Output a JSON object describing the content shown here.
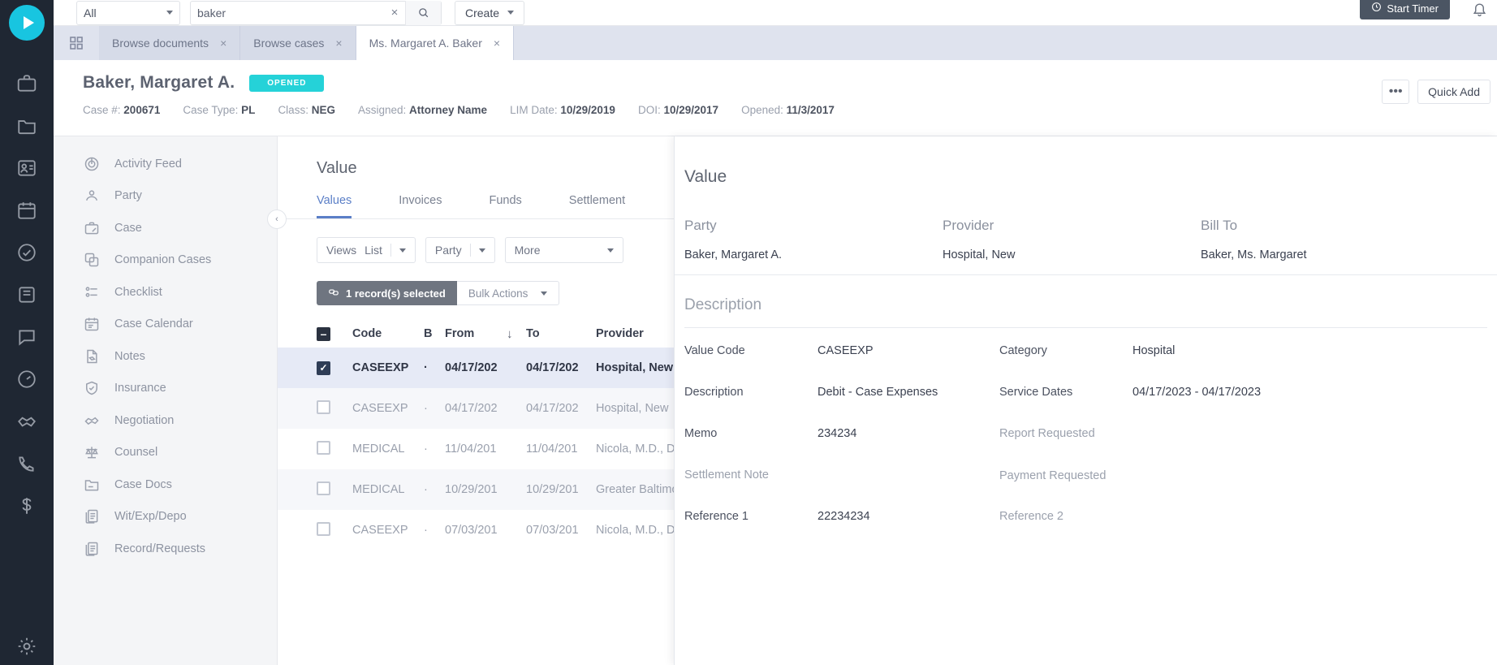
{
  "topbar": {
    "scope_label": "All",
    "search_value": "baker",
    "search_placeholder": "Search",
    "clear_label": "×",
    "create_label": "Create",
    "timer_label": "Start Timer"
  },
  "tabs": [
    {
      "label": "Browse documents",
      "close": "×",
      "active": false
    },
    {
      "label": "Browse cases",
      "close": "×",
      "active": false
    },
    {
      "label": "Ms. Margaret A. Baker",
      "close": "×",
      "active": true
    }
  ],
  "case_header": {
    "title": "Baker, Margaret A.",
    "status_badge": "OPENED",
    "meta": [
      {
        "label": "Case #:",
        "value": "200671"
      },
      {
        "label": "Case Type:",
        "value": "PL"
      },
      {
        "label": "Class:",
        "value": "NEG"
      },
      {
        "label": "Assigned:",
        "value": "Attorney Name"
      },
      {
        "label": "LIM Date:",
        "value": "10/29/2019"
      },
      {
        "label": "DOI:",
        "value": "10/29/2017"
      },
      {
        "label": "Opened:",
        "value": "11/3/2017"
      }
    ],
    "more_label": "•••",
    "quick_add_label": "Quick Add"
  },
  "sidebar": {
    "items": [
      {
        "label": "Activity Feed",
        "icon": "activity-feed-icon"
      },
      {
        "label": "Party",
        "icon": "party-icon"
      },
      {
        "label": "Case",
        "icon": "case-icon"
      },
      {
        "label": "Companion Cases",
        "icon": "companion-cases-icon"
      },
      {
        "label": "Checklist",
        "icon": "checklist-icon"
      },
      {
        "label": "Case Calendar",
        "icon": "calendar-icon"
      },
      {
        "label": "Notes",
        "icon": "notes-icon"
      },
      {
        "label": "Insurance",
        "icon": "shield-icon"
      },
      {
        "label": "Negotiation",
        "icon": "negotiation-icon"
      },
      {
        "label": "Counsel",
        "icon": "scales-icon"
      },
      {
        "label": "Case Docs",
        "icon": "folder-icon"
      },
      {
        "label": "Wit/Exp/Depo",
        "icon": "documents-icon"
      },
      {
        "label": "Record/Requests",
        "icon": "documents-icon"
      }
    ],
    "collapse_label": "‹"
  },
  "main": {
    "title": "Value",
    "tabs": [
      {
        "label": "Values",
        "active": true
      },
      {
        "label": "Invoices",
        "active": false
      },
      {
        "label": "Funds",
        "active": false
      },
      {
        "label": "Settlement",
        "active": false
      }
    ],
    "filters": [
      {
        "label": "Views",
        "value": "List"
      },
      {
        "label": "Party",
        "value": ""
      },
      {
        "label": "More",
        "value": ""
      }
    ],
    "bulk": {
      "count_label": "1 record(s) selected",
      "actions_label": "Bulk Actions"
    },
    "table": {
      "columns": [
        "Code",
        "B",
        "From",
        "To",
        "Provider"
      ],
      "sort_column": "From",
      "sort_direction": "↓",
      "header_checkbox": "indeterminate",
      "rows": [
        {
          "checked": true,
          "code": "CASEEXP",
          "b": "·",
          "from": "04/17/202",
          "to": "04/17/202",
          "provider": "Hospital, New"
        },
        {
          "checked": false,
          "code": "CASEEXP",
          "b": "·",
          "from": "04/17/202",
          "to": "04/17/202",
          "provider": "Hospital, New"
        },
        {
          "checked": false,
          "code": "MEDICAL",
          "b": "·",
          "from": "11/04/201",
          "to": "11/04/201",
          "provider": "Nicola, M.D., Dr. Cha"
        },
        {
          "checked": false,
          "code": "MEDICAL",
          "b": "·",
          "from": "10/29/201",
          "to": "10/29/201",
          "provider": "Greater Baltimore M"
        },
        {
          "checked": false,
          "code": "CASEEXP",
          "b": "·",
          "from": "07/03/201",
          "to": "07/03/201",
          "provider": "Nicola, M.D., Dr. Cha"
        }
      ]
    }
  },
  "drawer": {
    "title": "Value",
    "summary_columns": [
      "Party",
      "Provider",
      "Bill To"
    ],
    "summary_values": [
      "Baker, Margaret A.",
      "Hospital, New",
      "Baker, Ms. Margaret"
    ],
    "section_title": "Description",
    "fields_left": [
      {
        "label": "Value Code",
        "value": "CASEEXP",
        "muted": false
      },
      {
        "label": "Description",
        "value": "Debit - Case Expenses",
        "muted": false
      },
      {
        "label": "Memo",
        "value": "234234",
        "muted": false
      },
      {
        "label": "Settlement Note",
        "value": "",
        "muted": true
      },
      {
        "label": "Reference 1",
        "value": "22234234",
        "muted": false
      }
    ],
    "fields_right": [
      {
        "label": "Category",
        "value": "Hospital",
        "muted": false
      },
      {
        "label": "Service Dates",
        "value": "04/17/2023 - 04/17/2023",
        "muted": false
      },
      {
        "label": "Report Requested",
        "value": "",
        "muted": true
      },
      {
        "label": "Payment Requested",
        "value": "",
        "muted": true
      },
      {
        "label": "Reference 2",
        "value": "",
        "muted": true
      }
    ]
  },
  "colors": {
    "accent_teal": "#25d2d8",
    "accent_blue": "#5b7fc7",
    "rail_bg": "#1f2733",
    "selected_row": "#e6eaf6"
  }
}
